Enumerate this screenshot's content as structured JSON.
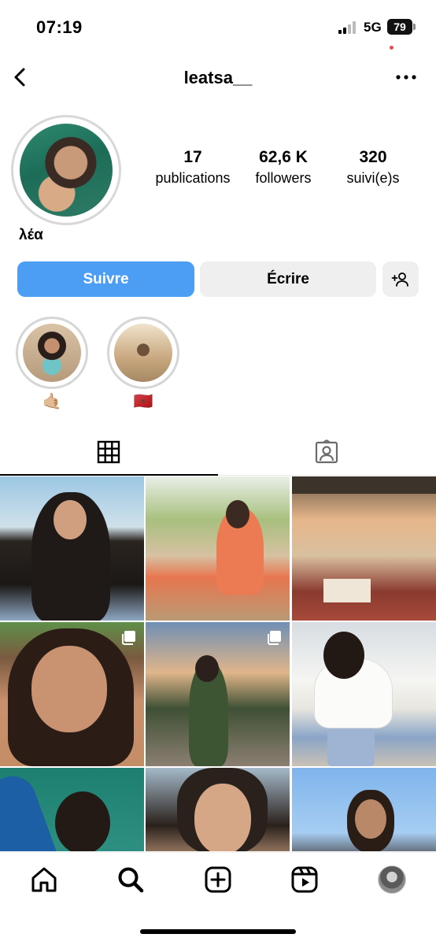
{
  "status_bar": {
    "time": "07:19",
    "network": "5G",
    "battery": "79"
  },
  "header": {
    "username": "leatsa__",
    "back_icon": "chevron-left-icon",
    "more_icon": "more-horizontal-icon"
  },
  "profile": {
    "display_name": "λέα",
    "stats": [
      {
        "value": "17",
        "label": "publications"
      },
      {
        "value": "62,6 K",
        "label": "followers"
      },
      {
        "value": "320",
        "label": "suivi(e)s"
      }
    ]
  },
  "actions": {
    "follow_label": "Suivre",
    "message_label": "Écrire",
    "add_user_icon": "add-person-icon"
  },
  "highlights": [
    {
      "label": "🤙🏼"
    },
    {
      "label": "🇲🇦"
    }
  ],
  "tabs": [
    {
      "icon": "grid-icon",
      "active": true
    },
    {
      "icon": "tagged-person-icon",
      "active": false
    }
  ],
  "grid": {
    "multi_photo_posts": [
      3,
      4
    ]
  },
  "bottom_nav": [
    {
      "icon": "home-icon"
    },
    {
      "icon": "search-icon"
    },
    {
      "icon": "create-icon"
    },
    {
      "icon": "reels-icon"
    },
    {
      "icon": "profile-avatar"
    }
  ],
  "colors": {
    "follow_button": "#4b9ef4",
    "secondary_button": "#efefef",
    "notification_dot": "#ed4956"
  }
}
